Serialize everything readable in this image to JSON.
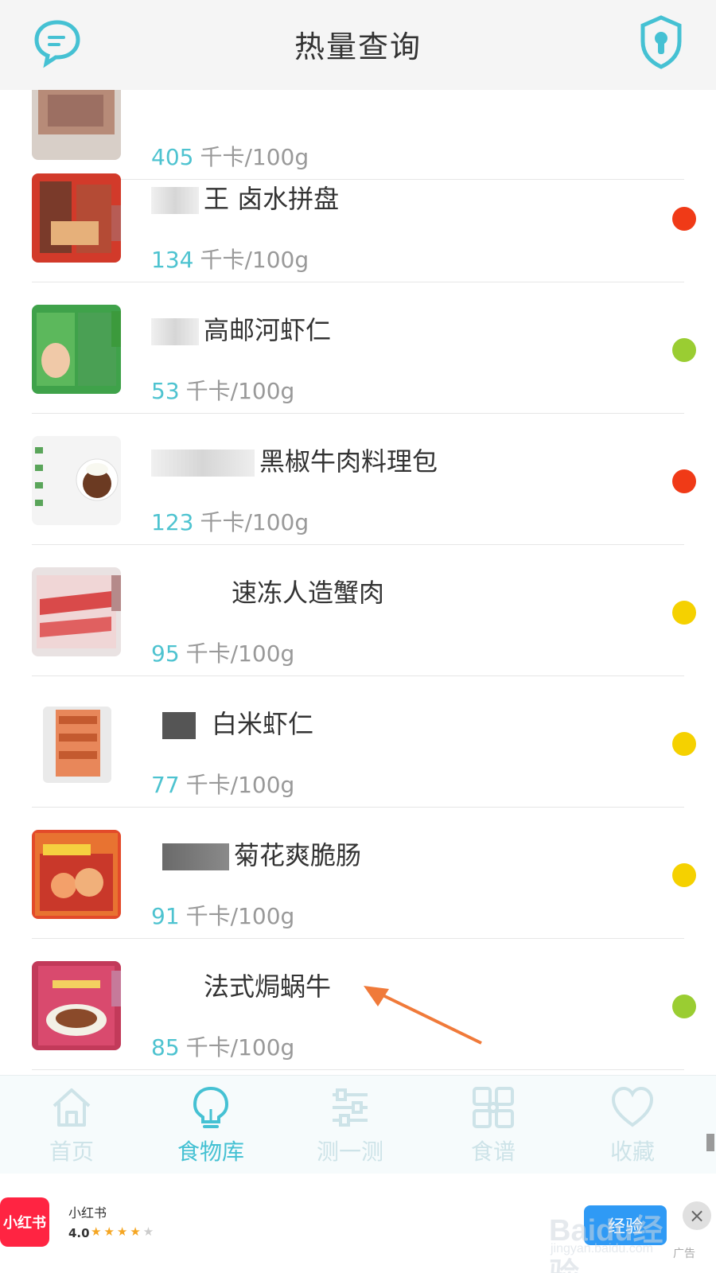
{
  "header": {
    "title": "热量查询",
    "left_icon": "chat-bubble-icon",
    "right_icon": "shield-lock-icon"
  },
  "colors": {
    "accent": "#45c1d3",
    "kcal_number": "#4ec3d0",
    "dot_red": "#f03a17",
    "dot_green": "#9acd32",
    "dot_yellow": "#f5d100"
  },
  "list": {
    "unit": "千卡/100g",
    "items": [
      {
        "name": "",
        "kcal": "405",
        "status": "red"
      },
      {
        "name": "王 卤水拼盘",
        "kcal": "134",
        "status": "red"
      },
      {
        "name": "高邮河虾仁",
        "kcal": "53",
        "status": "green"
      },
      {
        "name": "黑椒牛肉料理包",
        "kcal": "123",
        "status": "red"
      },
      {
        "name": "速冻人造蟹肉",
        "kcal": "95",
        "status": "yellow"
      },
      {
        "name": "白米虾仁",
        "kcal": "77",
        "status": "yellow"
      },
      {
        "name": "菊花爽脆肠",
        "kcal": "91",
        "status": "yellow"
      },
      {
        "name": "法式焗蜗牛",
        "kcal": "85",
        "status": "green"
      }
    ]
  },
  "tabs": [
    {
      "label": "首页",
      "icon": "home-icon",
      "active": false
    },
    {
      "label": "食物库",
      "icon": "lightbulb-icon",
      "active": true
    },
    {
      "label": "测一测",
      "icon": "sliders-icon",
      "active": false
    },
    {
      "label": "食谱",
      "icon": "grid-icon",
      "active": false
    },
    {
      "label": "收藏",
      "icon": "heart-icon",
      "active": false
    }
  ],
  "ad": {
    "logo_text": "小红书",
    "app_name": "小红书",
    "rating": "4.0",
    "button_label": "经验",
    "close_label": "×",
    "tag": "广告",
    "watermark": "Baidu经验",
    "watermark_url": "jingyan.baidu.com"
  }
}
